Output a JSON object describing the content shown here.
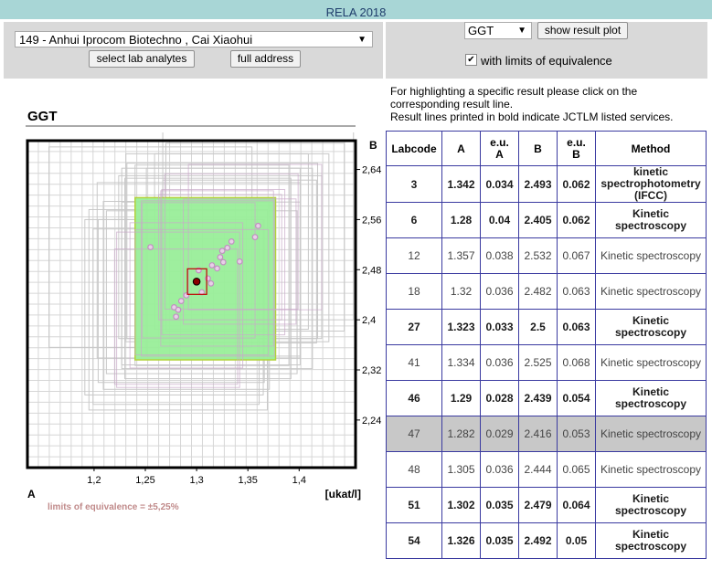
{
  "app_title": "RELA 2018",
  "lab_select": {
    "value": "149 - Anhui Iprocom Biotechno , Cai Xiaohui"
  },
  "buttons": {
    "select_lab_analytes": "select lab analytes",
    "full_address": "full address",
    "show_result_plot": "show result plot"
  },
  "analyte_select": {
    "value": "GGT"
  },
  "limits_checkbox": {
    "checked": true,
    "label": "with limits of equivalence"
  },
  "info": {
    "line1": "For highlighting a specific result please click on the corresponding result line.",
    "line2": "Result lines printed in bold indicate JCTLM listed services."
  },
  "table": {
    "headers": {
      "labcode": "Labcode",
      "a": "A",
      "eu_a": "e.u.\nA",
      "b": "B",
      "eu_b": "e.u.\nB",
      "method": "Method"
    },
    "rows": [
      {
        "labcode": "3",
        "a": "1.342",
        "eu_a": "0.034",
        "b": "2.493",
        "eu_b": "0.062",
        "method": "kinetic spectrophotometry (IFCC)",
        "bold": true
      },
      {
        "labcode": "6",
        "a": "1.28",
        "eu_a": "0.04",
        "b": "2.405",
        "eu_b": "0.062",
        "method": "Kinetic spectroscopy",
        "bold": true
      },
      {
        "labcode": "12",
        "a": "1.357",
        "eu_a": "0.038",
        "b": "2.532",
        "eu_b": "0.067",
        "method": "Kinetic spectroscopy",
        "bold": false
      },
      {
        "labcode": "18",
        "a": "1.32",
        "eu_a": "0.036",
        "b": "2.482",
        "eu_b": "0.063",
        "method": "Kinetic spectroscopy",
        "bold": false
      },
      {
        "labcode": "27",
        "a": "1.323",
        "eu_a": "0.033",
        "b": "2.5",
        "eu_b": "0.063",
        "method": "Kinetic spectroscopy",
        "bold": true
      },
      {
        "labcode": "41",
        "a": "1.334",
        "eu_a": "0.036",
        "b": "2.525",
        "eu_b": "0.068",
        "method": "Kinetic spectroscopy",
        "bold": false
      },
      {
        "labcode": "46",
        "a": "1.29",
        "eu_a": "0.028",
        "b": "2.439",
        "eu_b": "0.054",
        "method": "Kinetic spectroscopy",
        "bold": true
      },
      {
        "labcode": "47",
        "a": "1.282",
        "eu_a": "0.029",
        "b": "2.416",
        "eu_b": "0.053",
        "method": "Kinetic spectroscopy",
        "bold": false,
        "selected": true
      },
      {
        "labcode": "48",
        "a": "1.305",
        "eu_a": "0.036",
        "b": "2.444",
        "eu_b": "0.065",
        "method": "Kinetic spectroscopy",
        "bold": false
      },
      {
        "labcode": "51",
        "a": "1.302",
        "eu_a": "0.035",
        "b": "2.479",
        "eu_b": "0.064",
        "method": "Kinetic spectroscopy",
        "bold": true
      },
      {
        "labcode": "54",
        "a": "1.326",
        "eu_a": "0.035",
        "b": "2.492",
        "eu_b": "0.05",
        "method": "Kinetic spectroscopy",
        "bold": true
      }
    ]
  },
  "chart_data": {
    "type": "scatter",
    "title": "GGT",
    "xlabel": "A",
    "ylabel": "B",
    "unit": "[ukat/l]",
    "xlim": [
      1.135,
      1.455
    ],
    "ylim": [
      2.164,
      2.686
    ],
    "x_ticks": [
      1.2,
      1.25,
      1.3,
      1.35,
      1.4
    ],
    "x_tick_labels": [
      "1,2",
      "1,25",
      "1,3",
      "1,35",
      "1,4"
    ],
    "y_ticks": [
      2.24,
      2.32,
      2.4,
      2.48,
      2.56,
      2.64
    ],
    "y_tick_labels": [
      "2,24",
      "2,32",
      "2,4",
      "2,48",
      "2,56",
      "2,64"
    ],
    "grid": true,
    "equivalence_region": {
      "x": [
        1.24,
        1.377
      ],
      "y": [
        2.336,
        2.595
      ],
      "color": "#99ee99"
    },
    "selected_point": {
      "x": 1.3,
      "y": 2.461,
      "color": "#8b0000"
    },
    "points": [
      {
        "x": 1.342,
        "y": 2.493
      },
      {
        "x": 1.28,
        "y": 2.405
      },
      {
        "x": 1.357,
        "y": 2.532
      },
      {
        "x": 1.32,
        "y": 2.482
      },
      {
        "x": 1.323,
        "y": 2.5
      },
      {
        "x": 1.334,
        "y": 2.525
      },
      {
        "x": 1.29,
        "y": 2.439
      },
      {
        "x": 1.282,
        "y": 2.416
      },
      {
        "x": 1.305,
        "y": 2.444
      },
      {
        "x": 1.302,
        "y": 2.479
      },
      {
        "x": 1.326,
        "y": 2.492
      },
      {
        "x": 1.311,
        "y": 2.466
      },
      {
        "x": 1.314,
        "y": 2.458
      },
      {
        "x": 1.325,
        "y": 2.51
      },
      {
        "x": 1.33,
        "y": 2.515
      },
      {
        "x": 1.315,
        "y": 2.487
      },
      {
        "x": 1.285,
        "y": 2.43
      },
      {
        "x": 1.278,
        "y": 2.42
      },
      {
        "x": 1.36,
        "y": 2.55
      },
      {
        "x": 1.255,
        "y": 2.516
      }
    ],
    "limits_note": "limits of equivalence = ±5,25%"
  }
}
